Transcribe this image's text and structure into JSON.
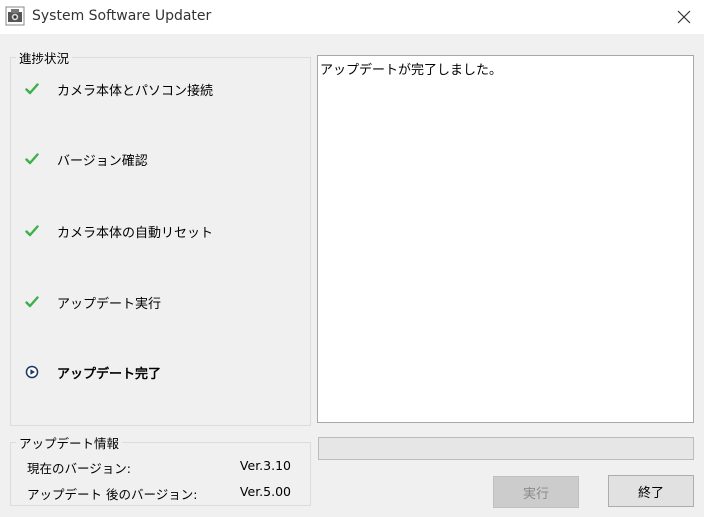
{
  "window": {
    "title": "System Software Updater"
  },
  "progress_group": {
    "legend": "進捗状況",
    "steps": [
      {
        "label": "カメラ本体とパソコン接続",
        "status": "done",
        "icon": "check-icon"
      },
      {
        "label": "バージョン確認",
        "status": "done",
        "icon": "check-icon"
      },
      {
        "label": "カメラ本体の自動リセット",
        "status": "done",
        "icon": "check-icon"
      },
      {
        "label": "アップデート実行",
        "status": "done",
        "icon": "check-icon"
      },
      {
        "label": "アップデート完了",
        "status": "current",
        "icon": "play-circle-icon"
      }
    ]
  },
  "log": {
    "text": "アップデートが完了しました。"
  },
  "info_group": {
    "legend": "アップデート情報",
    "current_version_label": "現在のバージョン:",
    "current_version_value": "Ver.3.10",
    "new_version_label": "アップデート 後のバージョン:",
    "new_version_value": "Ver.5.00"
  },
  "progress": {
    "value": 0
  },
  "buttons": {
    "run_label": "実行",
    "run_enabled": false,
    "exit_label": "終了"
  },
  "colors": {
    "check": "#3cb04a",
    "current_icon": "#1f3a68",
    "progress_fill": "#06b025"
  }
}
